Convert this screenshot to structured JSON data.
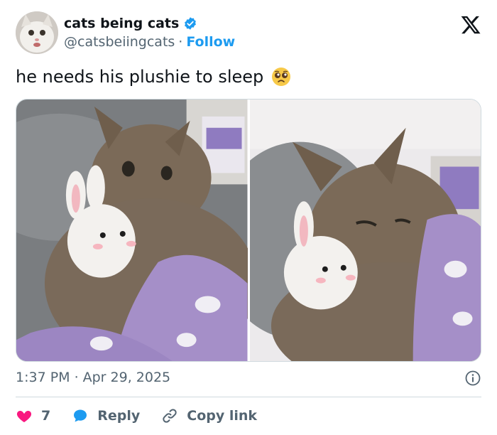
{
  "author": {
    "display_name": "cats being cats",
    "handle": "@catsbeiingcats",
    "separator": "·",
    "follow_label": "Follow",
    "verified_color": "#1d9bf0"
  },
  "tweet": {
    "text": "he needs his plushie to sleep",
    "emoji": "pleading-face-emoji"
  },
  "media": {
    "photos": [
      {
        "alt_icon": "cat-with-bunny-plush-photo-1"
      },
      {
        "alt_icon": "cat-with-bunny-plush-photo-2"
      }
    ]
  },
  "meta": {
    "time": "1:37 PM",
    "separator": "·",
    "date": "Apr 29, 2025"
  },
  "actions": {
    "like_count": "7",
    "reply_label": "Reply",
    "copy_link_label": "Copy link",
    "like_color": "#f91880",
    "reply_color": "#1d9bf0"
  },
  "colors": {
    "accent": "#1d9bf0",
    "muted": "#536471",
    "text": "#0f1419",
    "border": "#cfd9de"
  }
}
